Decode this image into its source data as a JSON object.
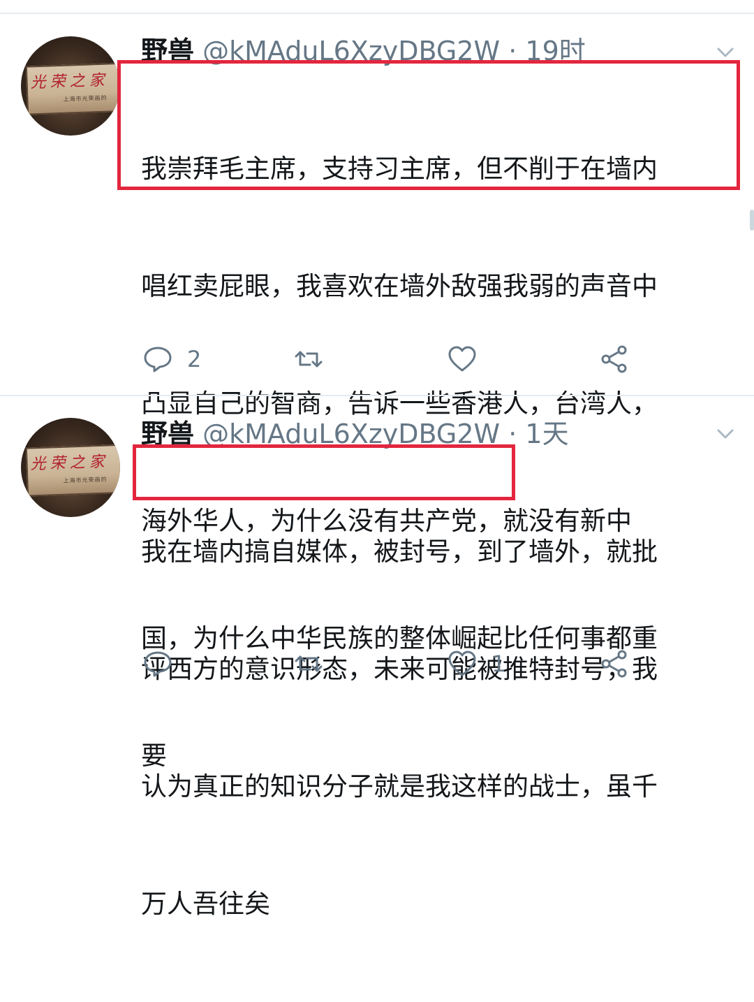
{
  "tweets": [
    {
      "name": "野兽",
      "handle": "@kMAduL6XzyDBG2W",
      "separator": "·",
      "time": "19时",
      "avatar_text": "光荣之家",
      "avatar_sub": "上海市光荣画的",
      "lines": [
        "我崇拜毛主席，支持习主席，但不削于在墙内",
        "唱红卖屁眼，我喜欢在墙外敌强我弱的声音中",
        "凸显自己的智商，告诉一些香港人，台湾人，",
        "海外华人，为什么没有共产党，就没有新中",
        "国，为什么中华民族的整体崛起比任何事都重",
        "要"
      ],
      "reply_count": "2",
      "retweet_count": "",
      "like_count": ""
    },
    {
      "name": "野兽",
      "handle": "@kMAduL6XzyDBG2W",
      "separator": "·",
      "time": "1天",
      "avatar_text": "光荣之家",
      "avatar_sub": "上海市光荣画的",
      "lines": [
        "我在墙内搞自媒体，被封号，到了墙外，就批",
        "评西方的意识形态，未来可能被推特封号，我",
        "认为真正的知识分子就是我这样的战士，虽千",
        "万人吾往矣"
      ],
      "reply_count": "",
      "retweet_count": "",
      "like_count": "1"
    }
  ],
  "colors": {
    "text": "#14171a",
    "secondary": "#657786",
    "highlight_box": "#e3263e",
    "divider": "#e6ecf0"
  },
  "icons": [
    "reply-icon",
    "retweet-icon",
    "like-icon",
    "share-icon",
    "chevron-down-icon"
  ]
}
